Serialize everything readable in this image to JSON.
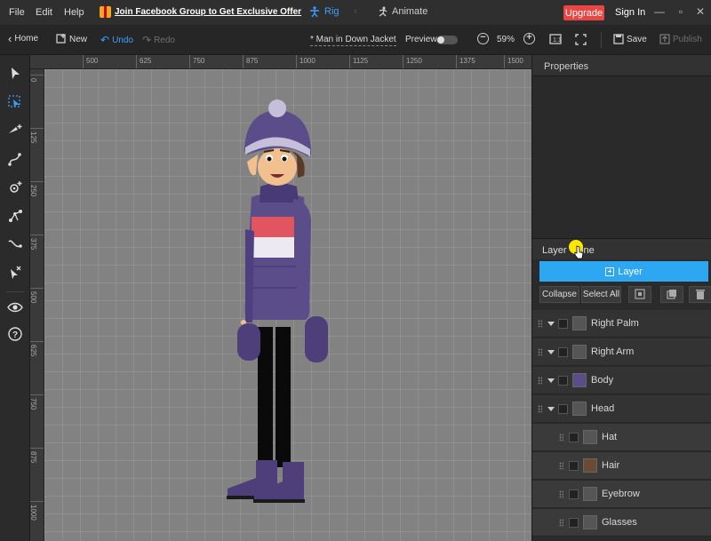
{
  "menu": {
    "file": "File",
    "edit": "Edit",
    "help": "Help"
  },
  "promo": {
    "text": "Join Facebook Group to Get Exclusive Offer"
  },
  "modes": {
    "rig": "Rig",
    "animate": "Animate"
  },
  "account": {
    "upgrade": "Upgrade",
    "signin": "Sign In"
  },
  "toolbar": {
    "home": "Home",
    "new": "New",
    "undo": "Undo",
    "redo": "Redo",
    "title": "* Man in Down Jacket",
    "preview": "Preview",
    "zoom": "59%",
    "save": "Save",
    "publish": "Publish"
  },
  "ruler": {
    "h": [
      "500",
      "625",
      "750",
      "875",
      "1000",
      "1125",
      "1250",
      "1375",
      "1500"
    ],
    "v": [
      "0",
      "125",
      "250",
      "375",
      "500",
      "625",
      "750",
      "875",
      "1000"
    ]
  },
  "panel": {
    "properties": "Properties",
    "layer_tab": "Layer",
    "bone_tab": "Bone",
    "add_layer": "Layer",
    "collapse": "Collapse",
    "select_all": "Select All"
  },
  "layers": [
    {
      "label": "Right Palm",
      "child": false
    },
    {
      "label": "Right Arm",
      "child": false
    },
    {
      "label": "Body",
      "child": false
    },
    {
      "label": "Head",
      "child": false
    },
    {
      "label": "Hat",
      "child": true
    },
    {
      "label": "Hair",
      "child": true
    },
    {
      "label": "Eyebrow",
      "child": true
    },
    {
      "label": "Glasses",
      "child": true
    }
  ],
  "colors": {
    "accent": "#2ea7f3",
    "upgrade": "#e84545",
    "jacket": "#5b4d8a",
    "stripe_red": "#e05560"
  }
}
